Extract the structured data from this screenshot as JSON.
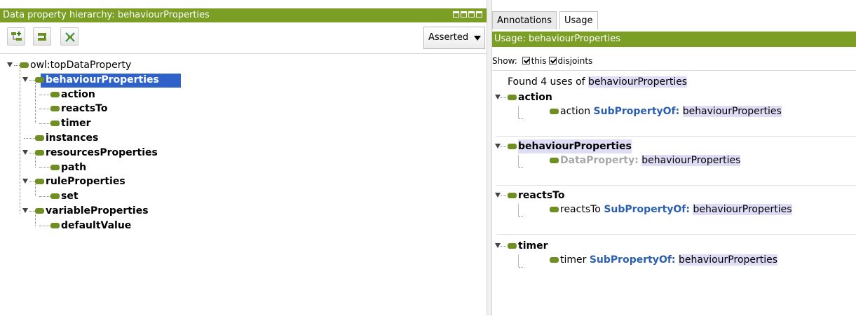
{
  "left_panel": {
    "title": "Data property hierarchy: behaviourProperties",
    "mode_select": {
      "selected": "Asserted"
    },
    "toolbar": [
      {
        "name": "add-subproperty-button",
        "icon": "add-sub-icon"
      },
      {
        "name": "add-sibling-button",
        "icon": "add-sibling-icon"
      },
      {
        "name": "delete-property-button",
        "icon": "delete-icon"
      }
    ],
    "tree": {
      "root": "owl:topDataProperty",
      "selected": "behaviourProperties",
      "nodes": [
        {
          "label": "behaviourProperties",
          "children": [
            "action",
            "reactsTo",
            "timer"
          ]
        },
        {
          "label": "instances",
          "children": []
        },
        {
          "label": "resourcesProperties",
          "children": [
            "path"
          ]
        },
        {
          "label": "ruleProperties",
          "children": [
            "set"
          ]
        },
        {
          "label": "variableProperties",
          "children": [
            "defaultValue"
          ]
        }
      ]
    }
  },
  "right_panel": {
    "tabs": [
      {
        "label": "Annotations",
        "active": false
      },
      {
        "label": "Usage",
        "active": true
      }
    ],
    "title": "Usage: behaviourProperties",
    "show": {
      "label": "Show:",
      "options": [
        {
          "label": "this",
          "checked": true
        },
        {
          "label": "disjoints",
          "checked": true
        }
      ]
    },
    "usage": {
      "header_prefix": "Found 4 uses of",
      "header_entity": "behaviourProperties",
      "groups": [
        {
          "title": "action",
          "subject": "action",
          "keyword": "SubPropertyOf:",
          "object": "behaviourProperties"
        },
        {
          "title": "behaviourProperties",
          "subject": "",
          "keyword": "DataProperty:",
          "object": "behaviourProperties"
        },
        {
          "title": "reactsTo",
          "subject": "reactsTo",
          "keyword": "SubPropertyOf:",
          "object": "behaviourProperties"
        },
        {
          "title": "timer",
          "subject": "timer",
          "keyword": "SubPropertyOf:",
          "object": "behaviourProperties"
        }
      ]
    }
  },
  "colors": {
    "titlebar": "#7a9f24",
    "entity_icon": "#6f8f23",
    "selection": "#2e62c9",
    "keyword": "#2a5fb3",
    "highlight": "#dfdcf6"
  }
}
